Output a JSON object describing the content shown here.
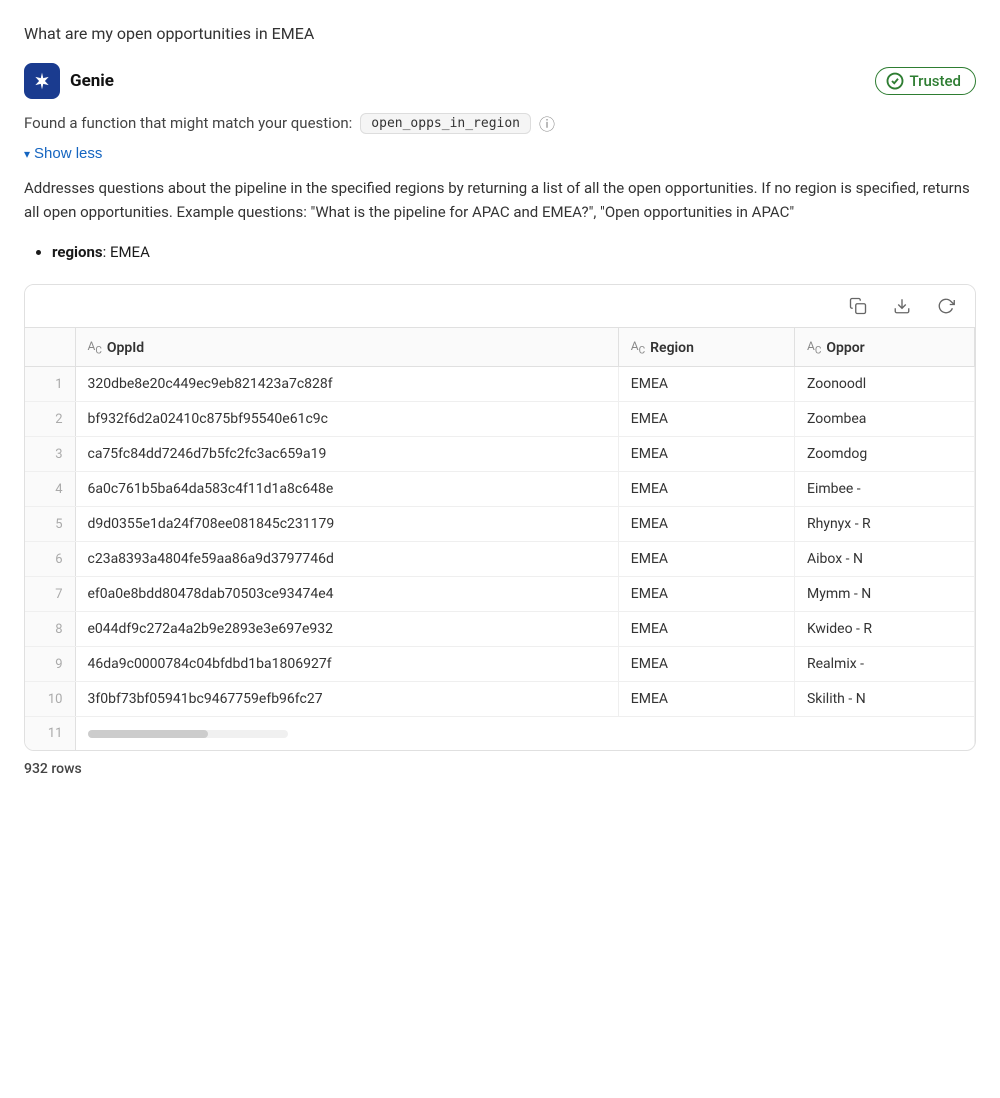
{
  "page": {
    "question": "What are my open opportunities in EMEA"
  },
  "genie": {
    "title": "Genie",
    "trusted_label": "Trusted",
    "function_match_text": "Found a function that might match your question:",
    "function_name": "open_opps_in_region",
    "show_less_label": "Show less",
    "description": "Addresses questions about the pipeline in the specified regions by returning a list of all the open opportunities. If no region is specified, returns all open opportunities. Example questions: \"What is the pipeline for APAC and EMEA?\", \"Open opportunities in APAC\"",
    "param_name": "regions",
    "param_value": "EMEA"
  },
  "toolbar": {
    "copy_icon": "⧉",
    "download_icon": "↓",
    "refresh_icon": "↺"
  },
  "table": {
    "columns": [
      {
        "id": "row_num",
        "label": ""
      },
      {
        "id": "oppid",
        "label": "OppId",
        "type": "ABC"
      },
      {
        "id": "region",
        "label": "Region",
        "type": "ABC"
      },
      {
        "id": "opportunity",
        "label": "Oppor",
        "type": "ABC"
      }
    ],
    "rows": [
      {
        "num": "1",
        "oppid": "320dbe8e20c449ec9eb821423a7c828f",
        "region": "EMEA",
        "opportunity": "Zoonoodl"
      },
      {
        "num": "2",
        "oppid": "bf932f6d2a02410c875bf95540e61c9c",
        "region": "EMEA",
        "opportunity": "Zoombea"
      },
      {
        "num": "3",
        "oppid": "ca75fc84dd7246d7b5fc2fc3ac659a19",
        "region": "EMEA",
        "opportunity": "Zoomdog"
      },
      {
        "num": "4",
        "oppid": "6a0c761b5ba64da583c4f11d1a8c648e",
        "region": "EMEA",
        "opportunity": "Eimbee -"
      },
      {
        "num": "5",
        "oppid": "d9d0355e1da24f708ee081845c231179",
        "region": "EMEA",
        "opportunity": "Rhynyx - R"
      },
      {
        "num": "6",
        "oppid": "c23a8393a4804fe59aa86a9d3797746d",
        "region": "EMEA",
        "opportunity": "Aibox - N"
      },
      {
        "num": "7",
        "oppid": "ef0a0e8bdd80478dab70503ce93474e4",
        "region": "EMEA",
        "opportunity": "Mymm - N"
      },
      {
        "num": "8",
        "oppid": "e044df9c272a4a2b9e2893e3e697e932",
        "region": "EMEA",
        "opportunity": "Kwideo - R"
      },
      {
        "num": "9",
        "oppid": "46da9c0000784c04bfdbd1ba1806927f",
        "region": "EMEA",
        "opportunity": "Realmix -"
      },
      {
        "num": "10",
        "oppid": "3f0bf73bf05941bc9467759efb96fc27",
        "region": "EMEA",
        "opportunity": "Skilith - N"
      },
      {
        "num": "11",
        "oppid": "",
        "region": "",
        "opportunity": ""
      }
    ],
    "rows_count": "932 rows"
  }
}
